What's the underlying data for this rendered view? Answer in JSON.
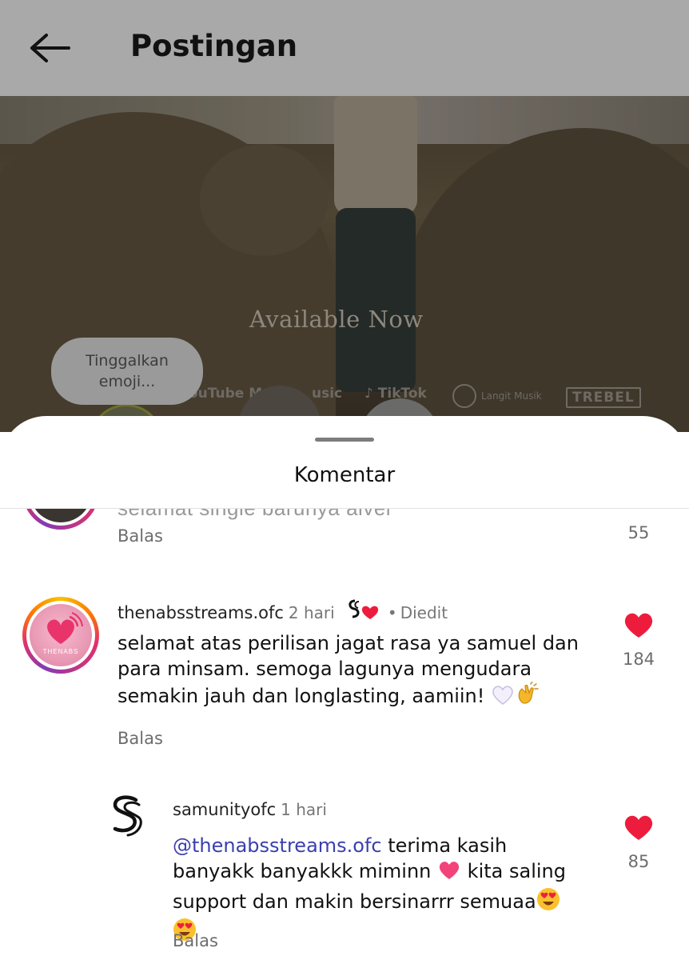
{
  "header": {
    "title": "Postingan",
    "back_icon": "arrow-left-icon"
  },
  "media": {
    "overlay_text": "Available Now",
    "platforms": [
      "ouTube Mu",
      "usic",
      "TikTok",
      "Langit Musik",
      "TREBEL"
    ],
    "tooltip": "Tinggalkan emoji..."
  },
  "sheet": {
    "title": "Komentar"
  },
  "comments": [
    {
      "partial": true,
      "text": "selamat single barunya alvel",
      "reply_label": "Balas",
      "likes": "55"
    },
    {
      "username": "thenabsstreams.ofc",
      "time": "2 hari",
      "edited": "Diedit",
      "text": "selamat atas perilisan jagat rasa ya samuel dan para minsam. semoga lagunya mengudara semakin jauh dan longlasting, aamiin!",
      "avatar_text": "THENABS",
      "reply_label": "Balas",
      "likes": "184"
    },
    {
      "username": "samunityofc",
      "time": "1 hari",
      "mention": "@thenabsstreams.ofc",
      "text": "terima kasih banyakk banyakkk miminn",
      "text_after_heart": "kita saling support dan makin bersinarrr semuaa",
      "reply_label": "Balas",
      "likes": "85"
    }
  ],
  "colors": {
    "heart": "#ed1c3c",
    "mention": "#3b3fae",
    "header_dim": "#a9a9a9"
  }
}
